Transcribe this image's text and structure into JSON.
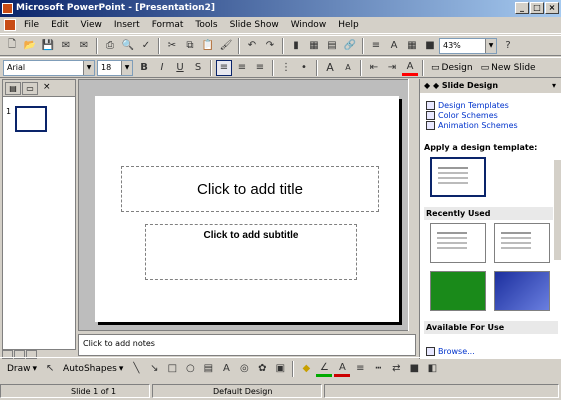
{
  "window": {
    "title": "Microsoft PowerPoint - [Presentation2]"
  },
  "menu": [
    "File",
    "Edit",
    "View",
    "Insert",
    "Format",
    "Tools",
    "Slide Show",
    "Window",
    "Help"
  ],
  "toolbar": {
    "zoom": "43%",
    "help": "?"
  },
  "format": {
    "font": "Arial",
    "size": "18",
    "bold": "B",
    "italic": "I",
    "underline": "U",
    "shadow": "S",
    "design": "Design",
    "new_slide": "New Slide",
    "grow": "A",
    "shrink": "A"
  },
  "outline": {
    "slide_number": "1"
  },
  "slide": {
    "title_placeholder": "Click to add title",
    "subtitle_placeholder": "Click to add subtitle"
  },
  "notes": {
    "placeholder": "Click to add notes"
  },
  "taskpane": {
    "title": "Slide Design",
    "links": [
      "Design Templates",
      "Color Schemes",
      "Animation Schemes"
    ],
    "apply_label": "Apply a design template:",
    "recently_used": "Recently Used",
    "available": "Available For Use",
    "browse": "Browse..."
  },
  "drawing": {
    "draw": "Draw",
    "autoshapes": "AutoShapes"
  },
  "status": {
    "slide_pos": "Slide 1 of 1",
    "design": "Default Design"
  },
  "colors": {
    "titlebar": "#0a246a",
    "link": "#0033cc"
  }
}
